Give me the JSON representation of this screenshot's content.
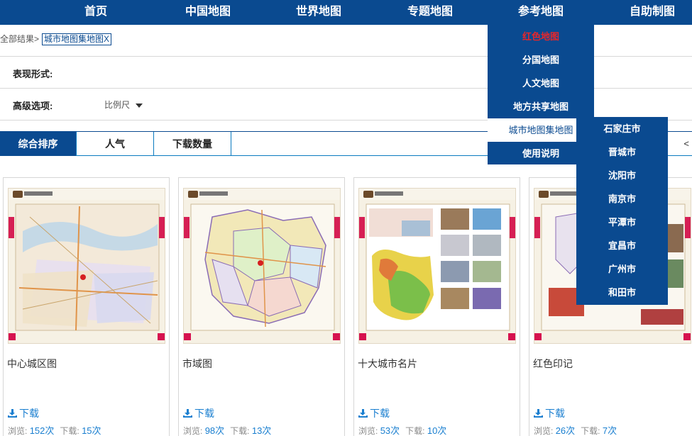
{
  "nav": {
    "items": [
      {
        "label": "首页"
      },
      {
        "label": "中国地图"
      },
      {
        "label": "世界地图"
      },
      {
        "label": "专题地图"
      },
      {
        "label": "参考地图"
      },
      {
        "label": "自助制图"
      }
    ]
  },
  "breadcrumb": {
    "root": "全部结果>",
    "tag": "城市地图集地图X"
  },
  "filters": {
    "form_label": "表现形式:",
    "advanced_label": "高级选项:",
    "scale_option": "比例尺"
  },
  "sort": {
    "tabs": [
      {
        "label": "综合排序"
      },
      {
        "label": "人气"
      },
      {
        "label": "下载数量"
      }
    ],
    "pager_prev": "<"
  },
  "cards": [
    {
      "title": "中心城区图",
      "download_label": "下载",
      "views_label": "浏览:",
      "views": "152次",
      "downloads_label": "下载:",
      "downloads": "15次"
    },
    {
      "title": "市域图",
      "download_label": "下载",
      "views_label": "浏览:",
      "views": "98次",
      "downloads_label": "下载:",
      "downloads": "13次"
    },
    {
      "title": "十大城市名片",
      "download_label": "下载",
      "views_label": "浏览:",
      "views": "53次",
      "downloads_label": "下载:",
      "downloads": "10次"
    },
    {
      "title": "红色印记",
      "download_label": "下载",
      "views_label": "浏览:",
      "views": "26次",
      "downloads_label": "下载:",
      "downloads": "7次"
    }
  ],
  "dropdown": {
    "items": [
      {
        "label": "红色地图"
      },
      {
        "label": "分国地图"
      },
      {
        "label": "人文地图"
      },
      {
        "label": "地方共享地图"
      },
      {
        "label": "城市地图集地图"
      },
      {
        "label": "使用说明"
      }
    ]
  },
  "submenu": {
    "items": [
      {
        "label": "石家庄市"
      },
      {
        "label": "晋城市"
      },
      {
        "label": "沈阳市"
      },
      {
        "label": "南京市"
      },
      {
        "label": "平潭市"
      },
      {
        "label": "宜昌市"
      },
      {
        "label": "广州市"
      },
      {
        "label": "和田市"
      }
    ]
  },
  "colors": {
    "nav_bg": "#0a4a90",
    "active_red": "#e8262a",
    "link_blue": "#1a7fd0",
    "accent_pink": "#d61f54"
  }
}
